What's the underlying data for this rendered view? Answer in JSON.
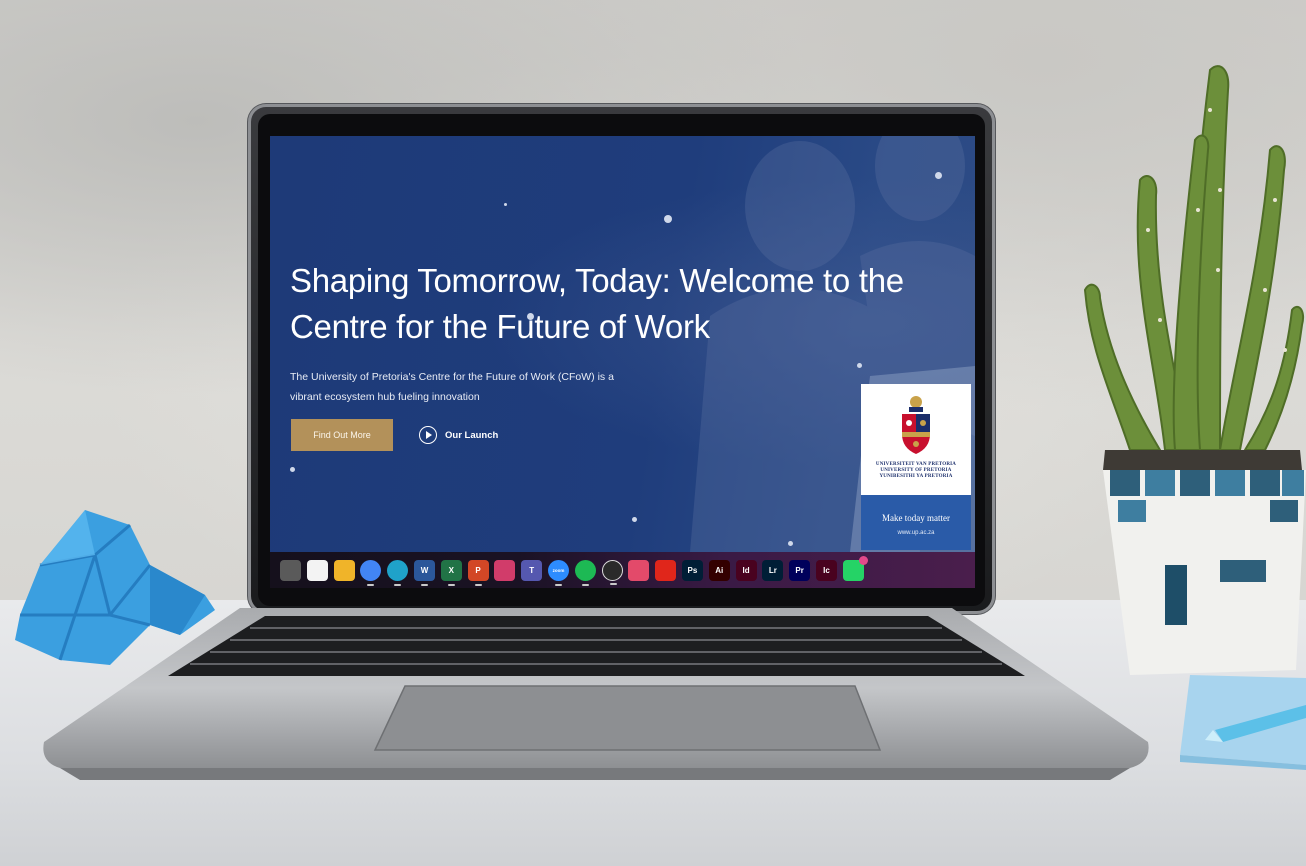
{
  "hero": {
    "title": "Shaping Tomorrow, Today: Welcome to the Centre for the Future of Work",
    "subtitle": "The University of Pretoria's Centre for the Future of Work (CFoW) is a vibrant ecosystem hub fueling innovation",
    "primary_button": "Find Out More",
    "secondary_button": "Our Launch"
  },
  "logo_card": {
    "name_line_1": "UNIVERSITEIT VAN PRETORIA",
    "name_line_2": "UNIVERSITY OF PRETORIA",
    "name_line_3": "YUNIBESITHI YA PRETORIA",
    "tagline": "Make today matter",
    "url": "www.up.ac.za"
  },
  "taskbar": {
    "apps": [
      {
        "icon": "task-view-icon",
        "label": "",
        "color": "#5a5a5a"
      },
      {
        "icon": "store-icon",
        "label": "",
        "color": "#f3f3f3"
      },
      {
        "icon": "file-explorer-icon",
        "label": "",
        "color": "#f0b429"
      },
      {
        "icon": "chrome-icon",
        "label": "",
        "color": "#4285f4"
      },
      {
        "icon": "edge-icon",
        "label": "",
        "color": "#1fa2c9"
      },
      {
        "icon": "word-icon",
        "label": "W",
        "color": "#2b579a"
      },
      {
        "icon": "excel-icon",
        "label": "X",
        "color": "#217346"
      },
      {
        "icon": "powerpoint-icon",
        "label": "P",
        "color": "#d24726"
      },
      {
        "icon": "snipping-tool-icon",
        "label": "",
        "color": "#d13c6a"
      },
      {
        "icon": "teams-icon",
        "label": "T",
        "color": "#5558af"
      },
      {
        "icon": "zoom-icon",
        "label": "zoom",
        "color": "#2d8cff"
      },
      {
        "icon": "spotify-icon",
        "label": "",
        "color": "#1db954"
      },
      {
        "icon": "media-player-icon",
        "label": "",
        "color": "#2a2a2a"
      },
      {
        "icon": "creative-cloud-icon",
        "label": "",
        "color": "#e34a6a"
      },
      {
        "icon": "acrobat-icon",
        "label": "",
        "color": "#e0261b"
      },
      {
        "icon": "photoshop-icon",
        "label": "Ps",
        "color": "#001e36"
      },
      {
        "icon": "illustrator-icon",
        "label": "Ai",
        "color": "#330000"
      },
      {
        "icon": "indesign-icon",
        "label": "Id",
        "color": "#49021f"
      },
      {
        "icon": "lightroom-icon",
        "label": "Lr",
        "color": "#001e36"
      },
      {
        "icon": "premiere-icon",
        "label": "Pr",
        "color": "#00005b"
      },
      {
        "icon": "incopy-icon",
        "label": "Ic",
        "color": "#49021f"
      },
      {
        "icon": "whatsapp-icon",
        "label": "",
        "color": "#25d366"
      }
    ]
  },
  "colors": {
    "hero_background": "#1f3d7c",
    "button_gold": "#b3915a",
    "up_blue": "#2a5ba8"
  }
}
